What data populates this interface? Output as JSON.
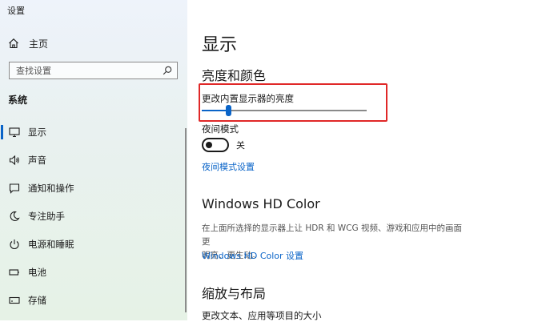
{
  "window": {
    "title": "设置"
  },
  "sidebar": {
    "home_label": "主页",
    "search_placeholder": "查找设置",
    "section_title": "系统",
    "items": [
      {
        "label": "显示",
        "icon": "monitor-icon",
        "active": true
      },
      {
        "label": "声音",
        "icon": "speaker-icon"
      },
      {
        "label": "通知和操作",
        "icon": "notification-icon"
      },
      {
        "label": "专注助手",
        "icon": "moon-icon"
      },
      {
        "label": "电源和睡眠",
        "icon": "power-icon"
      },
      {
        "label": "电池",
        "icon": "battery-icon"
      },
      {
        "label": "存储",
        "icon": "storage-icon"
      }
    ]
  },
  "main": {
    "title": "显示",
    "brightness_section": "亮度和颜色",
    "brightness_label": "更改内置显示器的亮度",
    "brightness_value": 0.16,
    "night_light_label": "夜间模式",
    "night_light_state": "关",
    "night_light_settings_link": "夜间模式设置",
    "hdr_section": "Windows HD Color",
    "hdr_desc_line1": "在上面所选择的显示器上让 HDR 和 WCG 视频、游戏和应用中的画面更",
    "hdr_desc_line2": "明亮、更生动。",
    "hdr_link": "Windows HD Color 设置",
    "scale_section": "缩放与布局",
    "scale_label": "更改文本、应用等项目的大小"
  },
  "colors": {
    "accent": "#0a64c8",
    "highlight": "#e02828"
  }
}
